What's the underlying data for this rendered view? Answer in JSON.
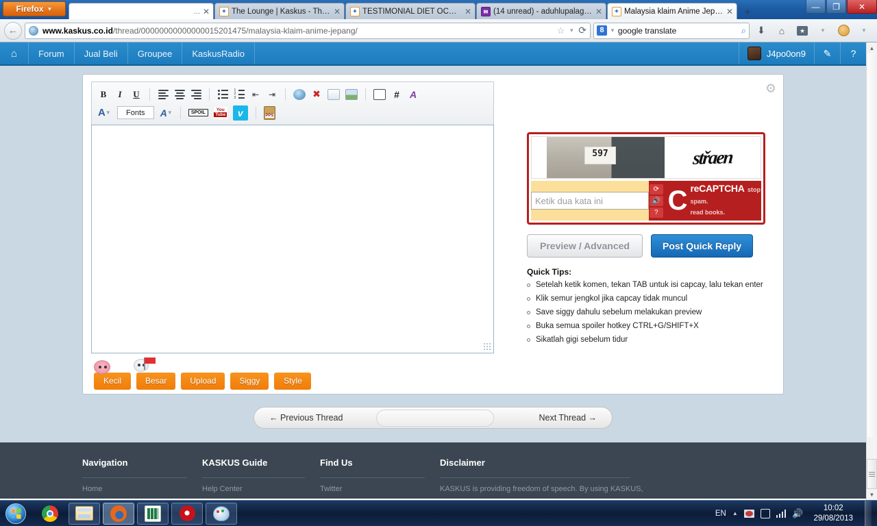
{
  "browser": {
    "firefox_button": "Firefox",
    "tabs": [
      {
        "title": "",
        "favicon": "blank-favicon",
        "state": "blank"
      },
      {
        "title": "The Lounge | Kaskus - The L...",
        "favicon": "kaskus-favicon",
        "state": "inactive"
      },
      {
        "title": "TESTIMONIAL DIET OCD (Co...",
        "favicon": "kaskus-favicon",
        "state": "inactive"
      },
      {
        "title": "(14 unread) - aduhlupalagi19...",
        "favicon": "mail-favicon",
        "state": "inactive"
      },
      {
        "title": "Malaysia klaim Anime Jepan...",
        "favicon": "kaskus-favicon",
        "state": "active"
      }
    ],
    "new_tab_label": "+",
    "window_controls": {
      "minimize": "—",
      "restore": "❐",
      "close": "✕"
    },
    "url_domain": "www.kaskus.co.id",
    "url_path": "/thread/00000000000000015201475/malaysia-klaim-anime-jepang/",
    "search_engine": "8",
    "search_value": "google translate",
    "search_placeholder": "Search"
  },
  "kaskus_nav": {
    "home_icon": "home-icon",
    "items": [
      "Forum",
      "Jual Beli",
      "Groupee",
      "KaskusRadio"
    ],
    "username": "J4po0on9",
    "compose_icon": "pencil-icon",
    "help_icon": "help-icon"
  },
  "editor": {
    "gear_icon": "gear-icon",
    "toolbar_row1": [
      {
        "name": "bold-button",
        "label": "B"
      },
      {
        "name": "italic-button",
        "label": "I"
      },
      {
        "name": "underline-button",
        "label": "U"
      },
      {
        "name": "align-left-button",
        "label": ""
      },
      {
        "name": "align-center-button",
        "label": ""
      },
      {
        "name": "align-right-button",
        "label": ""
      },
      {
        "name": "bullet-list-button",
        "label": ""
      },
      {
        "name": "numbered-list-button",
        "label": ""
      },
      {
        "name": "outdent-button",
        "label": ""
      },
      {
        "name": "indent-button",
        "label": ""
      },
      {
        "name": "insert-link-button",
        "label": ""
      },
      {
        "name": "remove-link-button",
        "label": ""
      },
      {
        "name": "insert-email-button",
        "label": ""
      },
      {
        "name": "insert-image-button",
        "label": ""
      },
      {
        "name": "insert-quote-button",
        "label": ""
      },
      {
        "name": "insert-code-button",
        "label": "#"
      },
      {
        "name": "remove-formatting-button",
        "label": ""
      }
    ],
    "font_color_label": "A",
    "fonts_label": "Fonts",
    "font_size_label": "A",
    "spoiler_label": "SPOIL",
    "youtube_label_top": "You",
    "youtube_label_bottom": "Tube",
    "vimeo_label": "v",
    "pps_label": "PPS",
    "textarea_value": "",
    "textarea_placeholder": "",
    "resize_grip": "resize-grip-icon",
    "bottom_buttons": [
      "Kecil",
      "Besar",
      "Upload",
      "Siggy",
      "Style"
    ]
  },
  "captcha": {
    "photo_plate_text": "597",
    "word": "střaen",
    "input_placeholder": "Ketik dua kata ini",
    "input_value": "",
    "refresh_icon": "refresh-icon",
    "audio_icon": "audio-icon",
    "help_icon": "question-icon",
    "brand_mark": "C",
    "brand_name": "reCAPTCHA",
    "brand_tm": "™",
    "brand_tagline_1": "stop spam.",
    "brand_tagline_2": "read books."
  },
  "actions": {
    "preview_label": "Preview / Advanced",
    "post_label": "Post Quick Reply"
  },
  "quick_tips": {
    "title": "Quick Tips:",
    "items": [
      "Setelah ketik komen, tekan TAB untuk isi capcay, lalu tekan enter",
      "Klik semur jengkol jika capcay tidak muncul",
      "Save siggy dahulu sebelum melakukan preview",
      "Buka semua spoiler hotkey CTRL+G/SHIFT+X",
      "Sikatlah gigi sebelum tidur"
    ]
  },
  "thread_nav": {
    "previous": "← Previous Thread",
    "next": "Next Thread →"
  },
  "footer": {
    "columns": [
      {
        "title": "Navigation",
        "sub": "Home"
      },
      {
        "title": "KASKUS Guide",
        "sub": "Help Center"
      },
      {
        "title": "Find Us",
        "sub": "Twitter"
      },
      {
        "title": "Disclaimer",
        "sub": "KASKUS is providing freedom of speech. By using KASKUS, you agree to"
      }
    ]
  },
  "taskbar": {
    "start_label": "start-orb",
    "items": [
      {
        "name": "taskbar-chrome",
        "icon": "chrome-icon"
      },
      {
        "name": "taskbar-explorer",
        "icon": "folder-icon"
      },
      {
        "name": "taskbar-firefox",
        "icon": "firefox-icon"
      },
      {
        "name": "taskbar-excel",
        "icon": "excel-icon"
      },
      {
        "name": "taskbar-opera",
        "icon": "opera-icon"
      },
      {
        "name": "taskbar-paint",
        "icon": "paint-icon"
      }
    ],
    "language": "EN",
    "time": "10:02",
    "date": "29/08/2013"
  },
  "colors": {
    "kaskus_blue": "#1c7cbd",
    "orange_button": "#f7931e",
    "post_button_blue": "#1668b5",
    "captcha_red": "#b61f1f",
    "footer_dark": "#3b4652"
  }
}
